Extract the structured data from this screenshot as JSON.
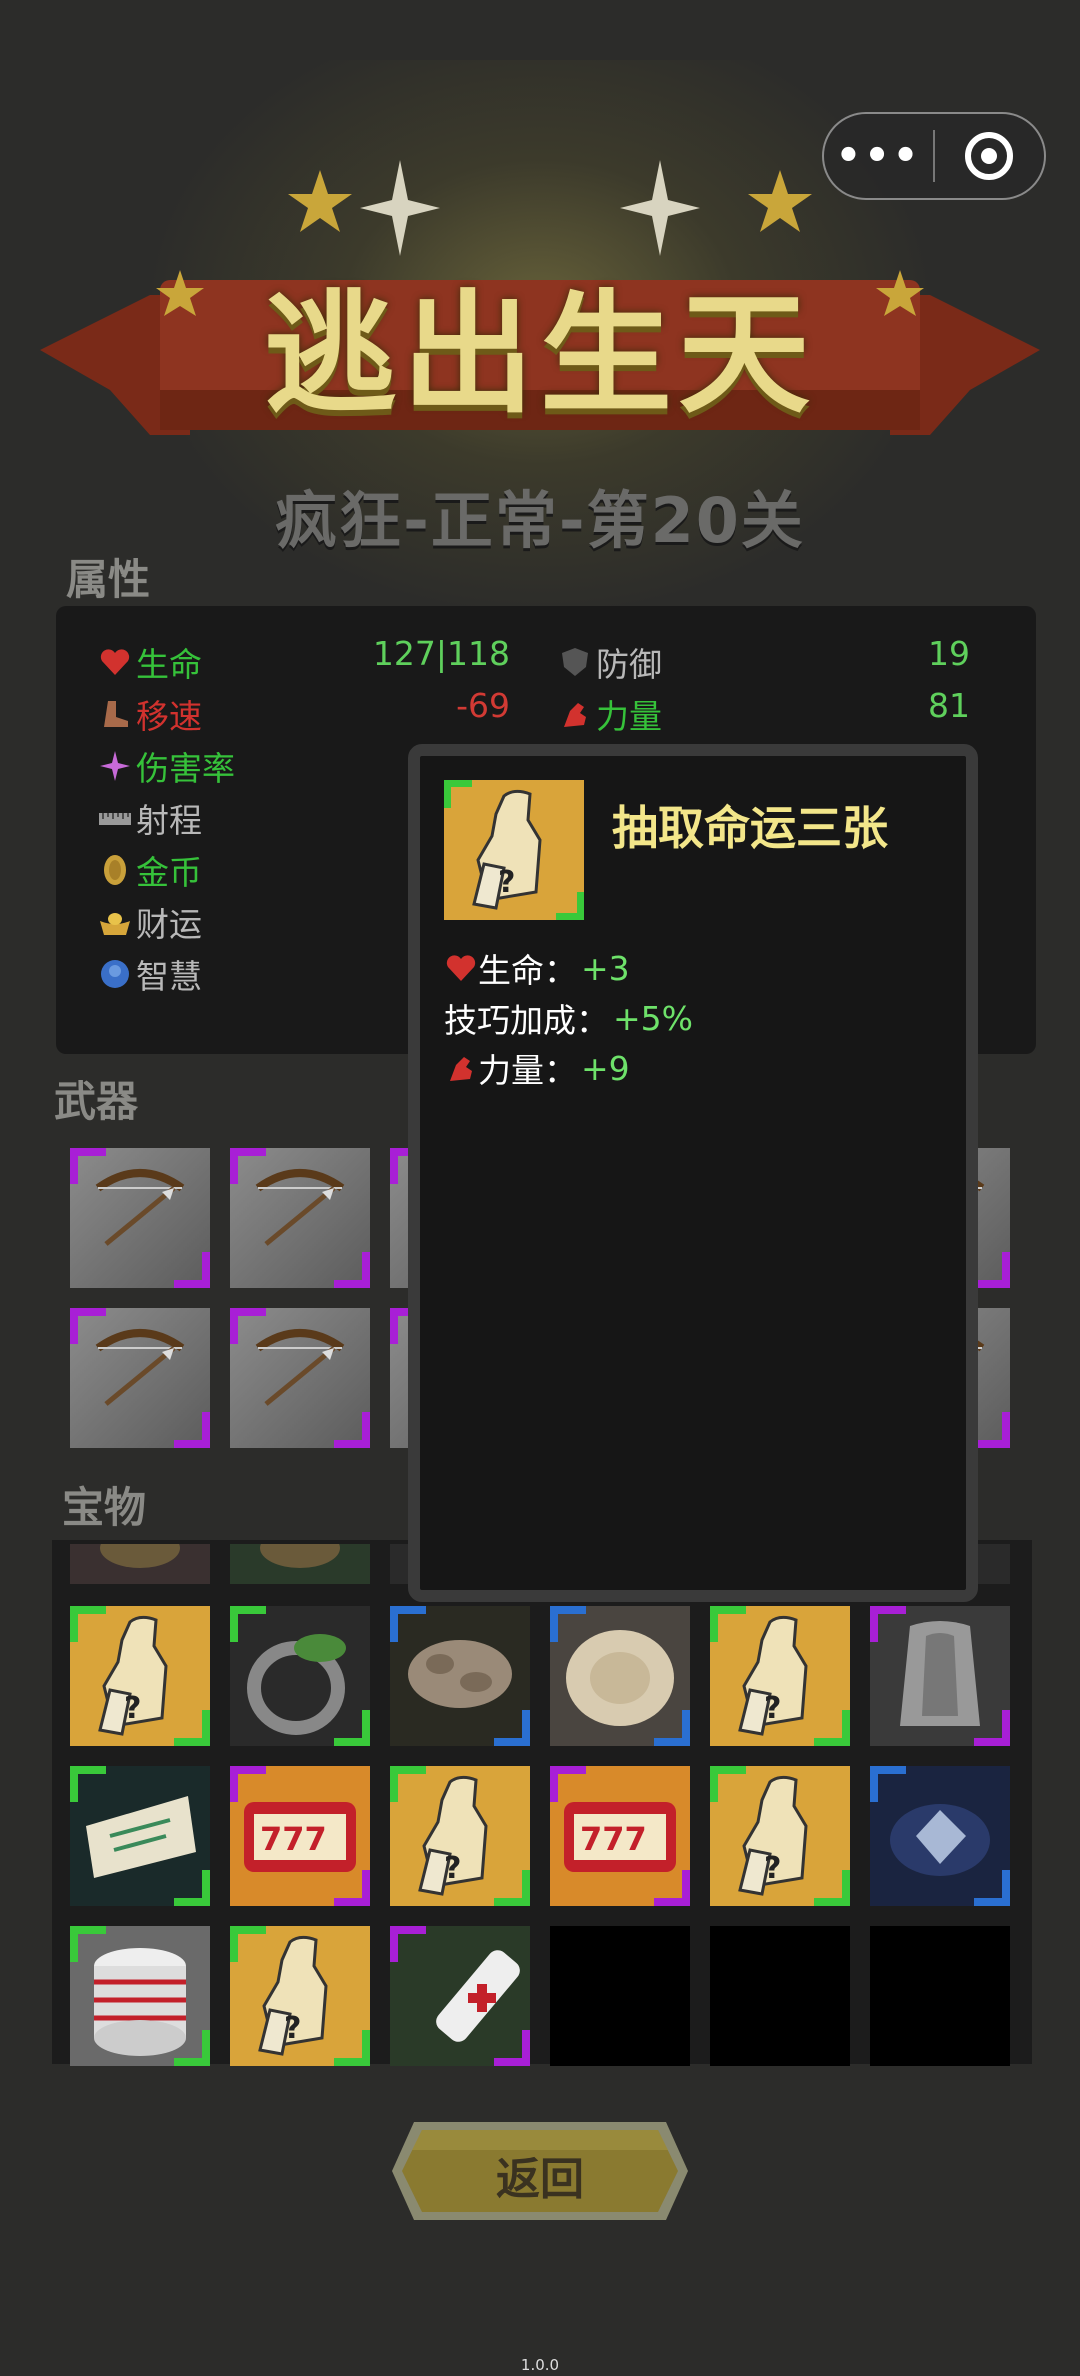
{
  "game_title": "逃出生天",
  "level_subtitle": "疯狂-正常-第20关",
  "sections": {
    "attributes": "属性",
    "weapons": "武器",
    "treasures": "宝物"
  },
  "stats": {
    "life": {
      "label": "生命",
      "value": "127|118"
    },
    "defense": {
      "label": "防御",
      "value": "19"
    },
    "move_speed": {
      "label": "移速",
      "value": "-69"
    },
    "strength": {
      "label": "力量",
      "value": "81"
    },
    "damage_rate": {
      "label": "伤害率"
    },
    "range": {
      "label": "射程"
    },
    "gold": {
      "label": "金币"
    },
    "luck": {
      "label": "财运"
    },
    "wisdom": {
      "label": "智慧"
    }
  },
  "popup": {
    "title": "抽取命运三张",
    "lines": [
      {
        "label": "生命：",
        "value": "+3"
      },
      {
        "label": "技巧加成：",
        "value": "+5%"
      },
      {
        "label": "力量：",
        "value": "+9"
      }
    ]
  },
  "back_button": "返回",
  "version": "1.0.0",
  "colors": {
    "rarity_green": "#39c93a",
    "rarity_purple": "#a81fd6",
    "rarity_blue": "#2a6fd1",
    "stat_label_green": "#36c23a",
    "stat_label_red": "#d2322e",
    "stat_label_gray": "#b8b8b8",
    "value_green": "#5fd05c",
    "value_red": "#d23a34",
    "popup_title": "#f3e68a"
  },
  "capsule": {
    "more_icon": "more-dots-icon",
    "close_icon": "target-close-icon"
  }
}
